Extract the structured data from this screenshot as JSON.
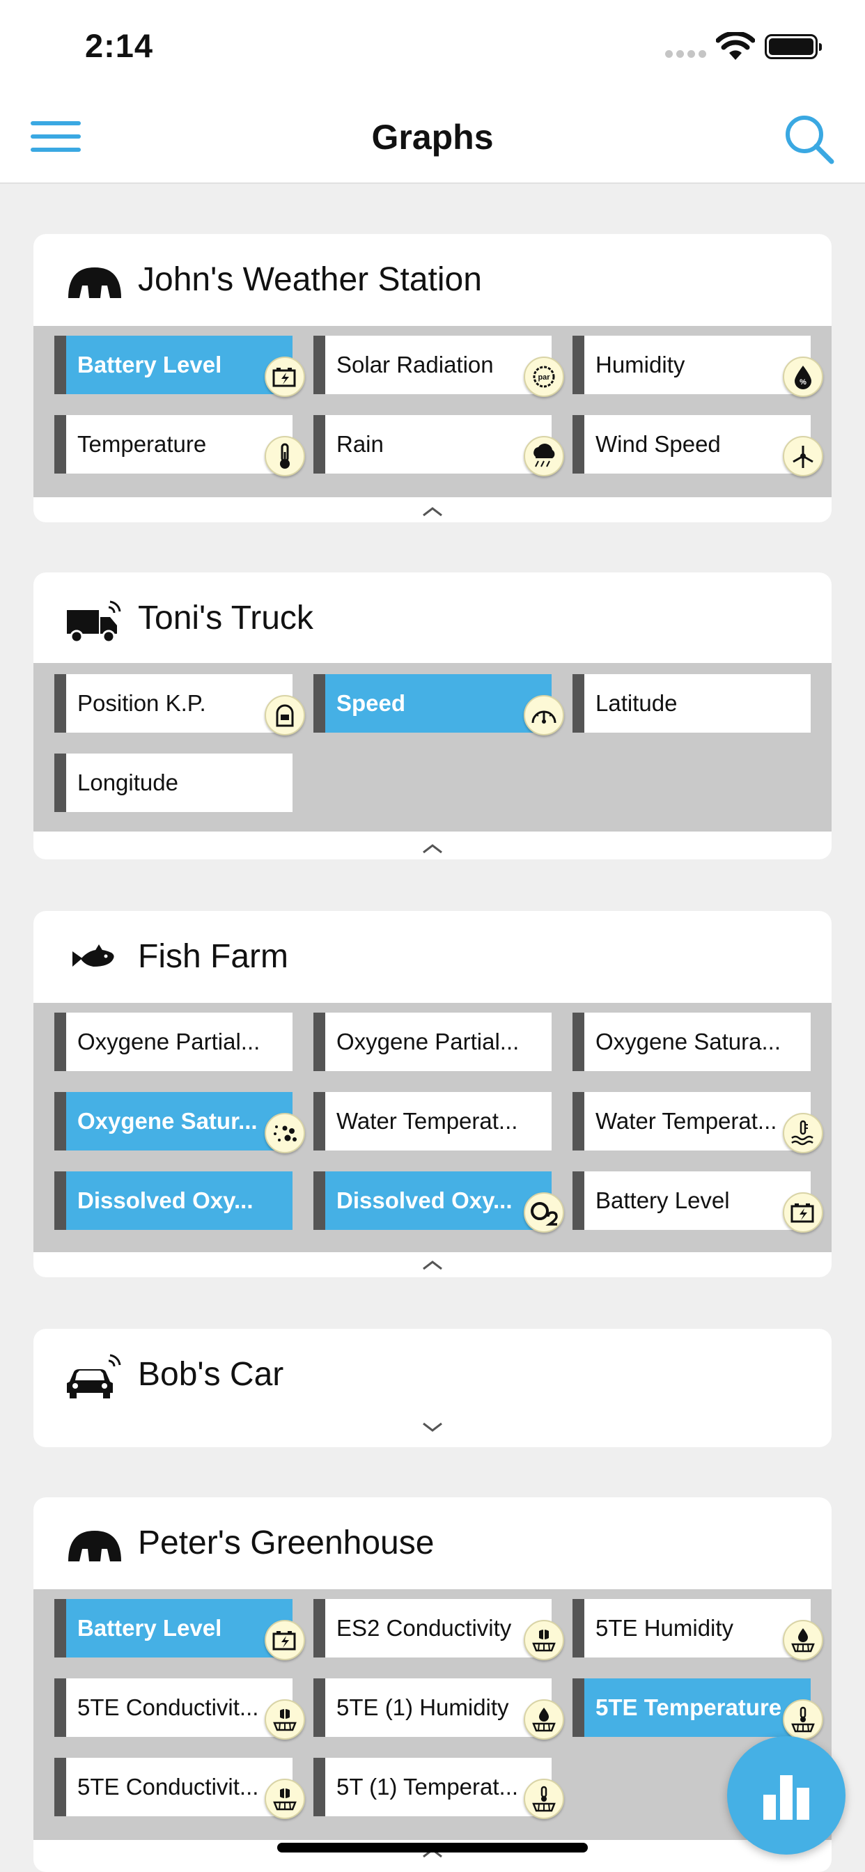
{
  "status_bar": {
    "time": "2:14"
  },
  "nav": {
    "title": "Graphs"
  },
  "colors": {
    "accent": "#3aa8e2",
    "tile_selected": "#45b0e5",
    "badge": "#fdf9d6"
  },
  "devices": [
    {
      "name": "John's Weather Station",
      "icon": "weather-station-icon",
      "expanded": true,
      "sensors": [
        {
          "label": "Battery Level",
          "selected": true,
          "icon": "battery-icon"
        },
        {
          "label": "Solar Radiation",
          "selected": false,
          "icon": "par-icon"
        },
        {
          "label": "Humidity",
          "selected": false,
          "icon": "humidity-icon"
        },
        {
          "label": "Temperature",
          "selected": false,
          "icon": "thermometer-icon"
        },
        {
          "label": "Rain",
          "selected": false,
          "icon": "rain-icon"
        },
        {
          "label": "Wind Speed",
          "selected": false,
          "icon": "wind-icon"
        }
      ]
    },
    {
      "name": "Toni's Truck",
      "icon": "truck-icon",
      "expanded": true,
      "sensors": [
        {
          "label": "Position K.P.",
          "selected": false,
          "icon": "milestone-icon"
        },
        {
          "label": "Speed",
          "selected": true,
          "icon": "speedometer-icon"
        },
        {
          "label": "Latitude",
          "selected": false,
          "icon": ""
        },
        {
          "label": "Longitude",
          "selected": false,
          "icon": ""
        }
      ]
    },
    {
      "name": "Fish Farm",
      "icon": "fish-icon",
      "expanded": true,
      "sensors": [
        {
          "label": "Oxygene Partial...",
          "selected": false,
          "icon": ""
        },
        {
          "label": "Oxygene Partial...",
          "selected": false,
          "icon": ""
        },
        {
          "label": "Oxygene Satura...",
          "selected": false,
          "icon": ""
        },
        {
          "label": "Oxygene Satur...",
          "selected": true,
          "icon": "bubbles-icon"
        },
        {
          "label": "Water Temperat...",
          "selected": false,
          "icon": ""
        },
        {
          "label": "Water Temperat...",
          "selected": false,
          "icon": "water-temperature-icon"
        },
        {
          "label": "Dissolved Oxy...",
          "selected": true,
          "icon": ""
        },
        {
          "label": "Dissolved Oxy...",
          "selected": true,
          "icon": "o2-icon"
        },
        {
          "label": "Battery Level",
          "selected": false,
          "icon": "battery-icon"
        }
      ]
    },
    {
      "name": "Bob's Car",
      "icon": "car-icon",
      "expanded": false,
      "sensors": []
    },
    {
      "name": "Peter's Greenhouse",
      "icon": "weather-station-icon",
      "expanded": true,
      "sensors": [
        {
          "label": "Battery Level",
          "selected": true,
          "icon": "battery-icon"
        },
        {
          "label": "ES2 Conductivity",
          "selected": false,
          "icon": "soil-conductivity-icon"
        },
        {
          "label": "5TE Humidity",
          "selected": false,
          "icon": "soil-humidity-icon"
        },
        {
          "label": "5TE Conductivit...",
          "selected": false,
          "icon": "soil-conductivity-icon"
        },
        {
          "label": "5TE (1) Humidity",
          "selected": false,
          "icon": "soil-humidity-icon"
        },
        {
          "label": "5TE Temperature",
          "selected": true,
          "icon": "soil-temperature-icon"
        },
        {
          "label": "5TE Conductivit...",
          "selected": false,
          "icon": "soil-conductivity-icon"
        },
        {
          "label": "5T (1) Temperat...",
          "selected": false,
          "icon": "soil-temperature-icon"
        }
      ]
    }
  ],
  "fab": {
    "icon": "bar-chart-icon"
  }
}
